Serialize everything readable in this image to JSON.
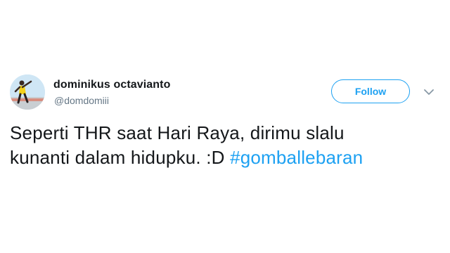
{
  "user": {
    "display_name": "dominikus octavianto",
    "handle": "@domdomiii",
    "avatar_icon": "profile-photo"
  },
  "follow_button": {
    "label": "Follow"
  },
  "menu": {
    "icon": "chevron-down-icon"
  },
  "tweet": {
    "line1": "Seperti THR saat Hari Raya, dirimu slalu",
    "line2_text": "kunanti dalam hidupku. :D ",
    "hashtag": "#gomballebaran"
  },
  "colors": {
    "accent": "#1da1f2",
    "text": "#14171a",
    "secondary": "#657786"
  }
}
